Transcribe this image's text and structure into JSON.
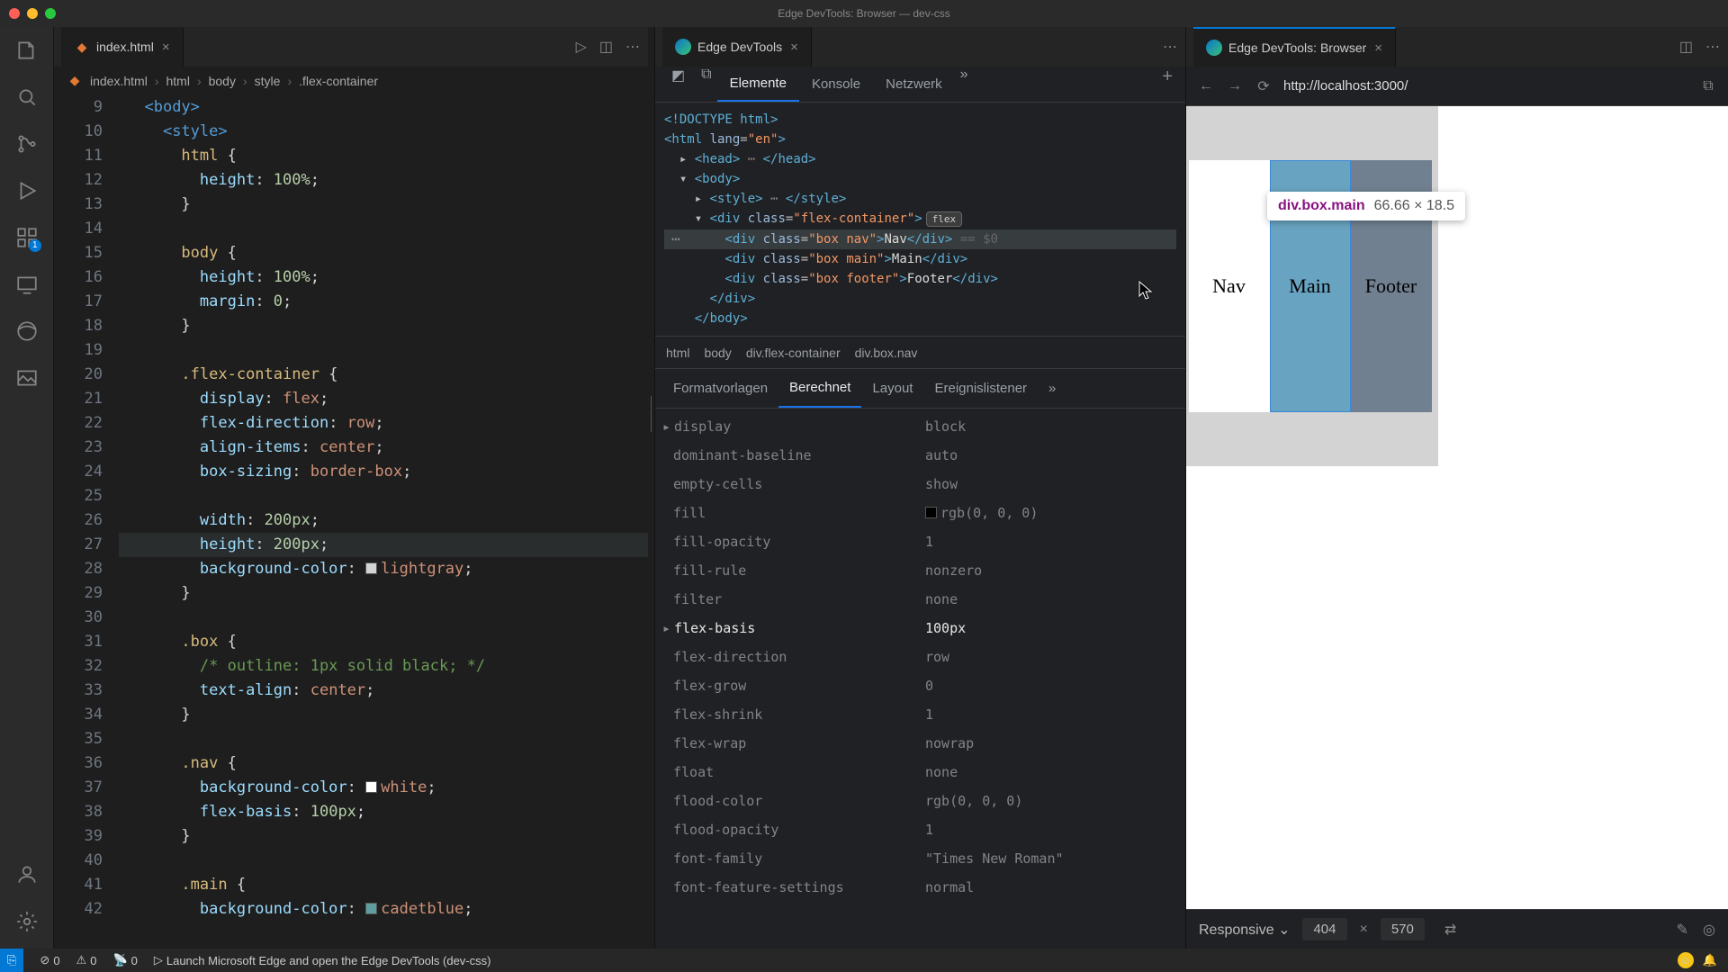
{
  "window": {
    "title": "Edge DevTools: Browser — dev-css"
  },
  "editor": {
    "tab_label": "index.html",
    "breadcrumb": [
      "index.html",
      "html",
      "body",
      "style",
      ".flex-container"
    ],
    "lines_start": 9,
    "lines": [
      [
        [
          "t-punc",
          "  "
        ],
        [
          "t-tag",
          "<body>"
        ]
      ],
      [
        [
          "t-punc",
          "    "
        ],
        [
          "t-tag",
          "<style>"
        ]
      ],
      [
        [
          "t-punc",
          "      "
        ],
        [
          "t-sel",
          "html"
        ],
        [
          "t-punc",
          " {"
        ]
      ],
      [
        [
          "t-punc",
          "        "
        ],
        [
          "t-prop",
          "height"
        ],
        [
          "t-punc",
          ": "
        ],
        [
          "t-num",
          "100%"
        ],
        [
          "t-punc",
          ";"
        ]
      ],
      [
        [
          "t-punc",
          "      }"
        ]
      ],
      [
        [
          "",
          ""
        ]
      ],
      [
        [
          "t-punc",
          "      "
        ],
        [
          "t-sel",
          "body"
        ],
        [
          "t-punc",
          " {"
        ]
      ],
      [
        [
          "t-punc",
          "        "
        ],
        [
          "t-prop",
          "height"
        ],
        [
          "t-punc",
          ": "
        ],
        [
          "t-num",
          "100%"
        ],
        [
          "t-punc",
          ";"
        ]
      ],
      [
        [
          "t-punc",
          "        "
        ],
        [
          "t-prop",
          "margin"
        ],
        [
          "t-punc",
          ": "
        ],
        [
          "t-num",
          "0"
        ],
        [
          "t-punc",
          ";"
        ]
      ],
      [
        [
          "t-punc",
          "      }"
        ]
      ],
      [
        [
          "",
          ""
        ]
      ],
      [
        [
          "t-punc",
          "      "
        ],
        [
          "t-sel",
          ".flex-container"
        ],
        [
          "t-punc",
          " {"
        ]
      ],
      [
        [
          "t-punc",
          "        "
        ],
        [
          "t-prop",
          "display"
        ],
        [
          "t-punc",
          ": "
        ],
        [
          "t-val",
          "flex"
        ],
        [
          "t-punc",
          ";"
        ]
      ],
      [
        [
          "t-punc",
          "        "
        ],
        [
          "t-prop",
          "flex-direction"
        ],
        [
          "t-punc",
          ": "
        ],
        [
          "t-val",
          "row"
        ],
        [
          "t-punc",
          ";"
        ]
      ],
      [
        [
          "t-punc",
          "        "
        ],
        [
          "t-prop",
          "align-items"
        ],
        [
          "t-punc",
          ": "
        ],
        [
          "t-val",
          "center"
        ],
        [
          "t-punc",
          ";"
        ]
      ],
      [
        [
          "t-punc",
          "        "
        ],
        [
          "t-prop",
          "box-sizing"
        ],
        [
          "t-punc",
          ": "
        ],
        [
          "t-val",
          "border-box"
        ],
        [
          "t-punc",
          ";"
        ]
      ],
      [
        [
          "",
          ""
        ]
      ],
      [
        [
          "t-punc",
          "        "
        ],
        [
          "t-prop",
          "width"
        ],
        [
          "t-punc",
          ": "
        ],
        [
          "t-num",
          "200px"
        ],
        [
          "t-punc",
          ";"
        ]
      ],
      [
        [
          "t-punc",
          "        "
        ],
        [
          "t-prop",
          "height"
        ],
        [
          "t-punc",
          ": "
        ],
        [
          "t-num",
          "200px"
        ],
        [
          "t-punc",
          ";"
        ]
      ],
      [
        [
          "t-punc",
          "        "
        ],
        [
          "t-prop",
          "background-color"
        ],
        [
          "t-punc",
          ": "
        ],
        [
          "cb",
          "#d3d3d3"
        ],
        [
          "t-val",
          "lightgray"
        ],
        [
          "t-punc",
          ";"
        ]
      ],
      [
        [
          "t-punc",
          "      }"
        ]
      ],
      [
        [
          "",
          ""
        ]
      ],
      [
        [
          "t-punc",
          "      "
        ],
        [
          "t-sel",
          ".box"
        ],
        [
          "t-punc",
          " {"
        ]
      ],
      [
        [
          "t-punc",
          "        "
        ],
        [
          "t-comm",
          "/* outline: 1px solid black; */"
        ]
      ],
      [
        [
          "t-punc",
          "        "
        ],
        [
          "t-prop",
          "text-align"
        ],
        [
          "t-punc",
          ": "
        ],
        [
          "t-val",
          "center"
        ],
        [
          "t-punc",
          ";"
        ]
      ],
      [
        [
          "t-punc",
          "      }"
        ]
      ],
      [
        [
          "",
          ""
        ]
      ],
      [
        [
          "t-punc",
          "      "
        ],
        [
          "t-sel",
          ".nav"
        ],
        [
          "t-punc",
          " {"
        ]
      ],
      [
        [
          "t-punc",
          "        "
        ],
        [
          "t-prop",
          "background-color"
        ],
        [
          "t-punc",
          ": "
        ],
        [
          "cb",
          "#ffffff"
        ],
        [
          "t-val",
          "white"
        ],
        [
          "t-punc",
          ";"
        ]
      ],
      [
        [
          "t-punc",
          "        "
        ],
        [
          "t-prop",
          "flex-basis"
        ],
        [
          "t-punc",
          ": "
        ],
        [
          "t-num",
          "100px"
        ],
        [
          "t-punc",
          ";"
        ]
      ],
      [
        [
          "t-punc",
          "      }"
        ]
      ],
      [
        [
          "",
          ""
        ]
      ],
      [
        [
          "t-punc",
          "      "
        ],
        [
          "t-sel",
          ".main"
        ],
        [
          "t-punc",
          " {"
        ]
      ],
      [
        [
          "t-punc",
          "        "
        ],
        [
          "t-prop",
          "background-color"
        ],
        [
          "t-punc",
          ": "
        ],
        [
          "cb",
          "#5f9ea0"
        ],
        [
          "t-val",
          "cadetblue"
        ],
        [
          "t-punc",
          ";"
        ]
      ]
    ],
    "current_line": 27
  },
  "devtools": {
    "tab_label": "Edge DevTools",
    "top_tabs": [
      "Elemente",
      "Konsole",
      "Netzwerk"
    ],
    "top_active": 0,
    "dom_crumb": [
      "html",
      "body",
      "div.flex-container",
      "div.box.nav"
    ],
    "styles_tabs": [
      "Formatvorlagen",
      "Berechnet",
      "Layout",
      "Ereignislistener"
    ],
    "styles_active": 1,
    "dom_html": {
      "doctype": "<!DOCTYPE html>",
      "lang": "en",
      "flex_label": "flex",
      "eq": "== $0",
      "nav": "Nav",
      "main": "Main",
      "footer": "Footer"
    },
    "computed": [
      {
        "n": "display",
        "v": "block",
        "strong": false,
        "tri": true
      },
      {
        "n": "dominant-baseline",
        "v": "auto"
      },
      {
        "n": "empty-cells",
        "v": "show"
      },
      {
        "n": "fill",
        "v": "rgb(0, 0, 0)",
        "swatch": "#000"
      },
      {
        "n": "fill-opacity",
        "v": "1"
      },
      {
        "n": "fill-rule",
        "v": "nonzero"
      },
      {
        "n": "filter",
        "v": "none"
      },
      {
        "n": "flex-basis",
        "v": "100px",
        "strong": true,
        "tri": true
      },
      {
        "n": "flex-direction",
        "v": "row"
      },
      {
        "n": "flex-grow",
        "v": "0"
      },
      {
        "n": "flex-shrink",
        "v": "1"
      },
      {
        "n": "flex-wrap",
        "v": "nowrap"
      },
      {
        "n": "float",
        "v": "none"
      },
      {
        "n": "flood-color",
        "v": "rgb(0, 0, 0)"
      },
      {
        "n": "flood-opacity",
        "v": "1"
      },
      {
        "n": "font-family",
        "v": "\"Times New Roman\""
      },
      {
        "n": "font-feature-settings",
        "v": "normal"
      }
    ]
  },
  "browser": {
    "tab_label": "Edge DevTools: Browser",
    "url": "http://localhost:3000/",
    "tooltip_name": "div.box.main",
    "tooltip_dim": "66.66 × 18.5",
    "nav": "Nav",
    "main": "Main",
    "footer": "Footer",
    "responsive_label": "Responsive",
    "w": "404",
    "h": "570"
  },
  "status": {
    "errors": "0",
    "warnings": "0",
    "port": "0",
    "msg": "Launch Microsoft Edge and open the Edge DevTools (dev-css)"
  },
  "activity_badge": "1"
}
